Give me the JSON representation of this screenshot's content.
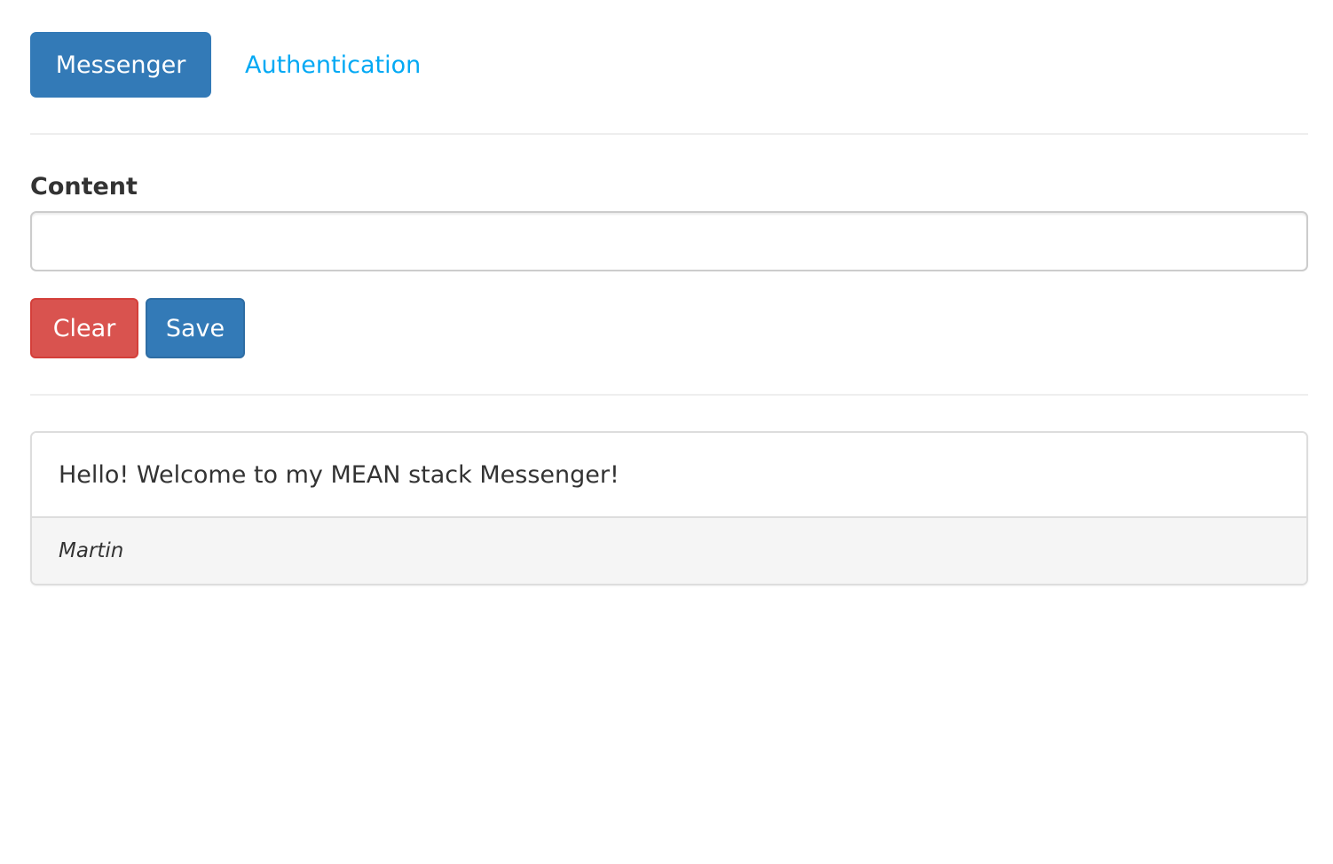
{
  "nav": {
    "items": [
      {
        "label": "Messenger",
        "active": true
      },
      {
        "label": "Authentication",
        "active": false
      }
    ]
  },
  "form": {
    "content_label": "Content",
    "content_value": "",
    "content_placeholder": "",
    "clear_label": "Clear",
    "save_label": "Save"
  },
  "messages": [
    {
      "content": "Hello! Welcome to my MEAN stack Messenger!",
      "author": "Martin"
    }
  ],
  "colors": {
    "primary": "#337ab7",
    "danger": "#d9534f",
    "link": "#03a9f4",
    "footer_bg": "#f5f5f5"
  }
}
